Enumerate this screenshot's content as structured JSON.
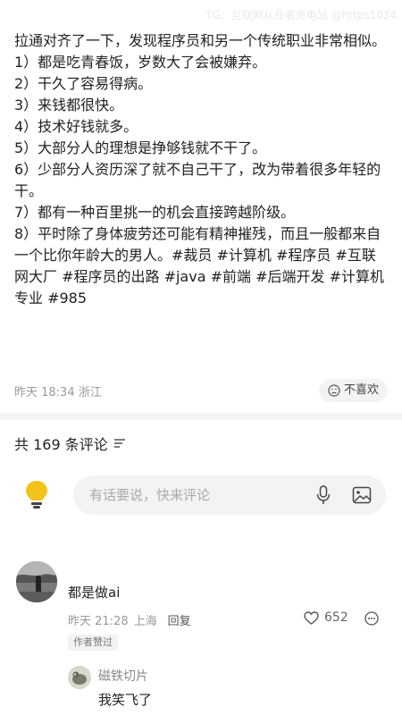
{
  "watermark": "TG：互联网从业者充电站 @https1024",
  "post": {
    "lines": [
      "拉通对齐了一下，发现程序员和另一个传统职业非常相似。",
      "1）都是吃青春饭，岁数大了会被嫌弃。",
      "2）干久了容易得病。",
      "3）来钱都很快。",
      "4）技术好钱就多。",
      "5）大部分人的理想是挣够钱就不干了。",
      "6）少部分人资历深了就不自己干了，改为带着很多年轻的干。",
      "7）都有一种百里挑一的机会直接跨越阶级。",
      "8）平时除了身体疲劳还可能有精神摧残，而且一般都来自一个比你年龄大的男人。#裁员 #计算机 #程序员 #互联网大厂 #程序员的出路 #java #前端 #后端开发 #计算机专业 #985"
    ],
    "time": "昨天 18:34 浙江",
    "dislike_label": "不喜欢"
  },
  "comments_header": "共 169 条评论",
  "comment_input": {
    "placeholder": "有话要说，快来评论"
  },
  "comment": {
    "text": "都是做ai",
    "time": "昨天 21:28",
    "location": "上海",
    "reply_label": "回复",
    "likes": "652",
    "badge": "作者赞过"
  },
  "sub_reply": {
    "name": "磁铁切片",
    "text": "我笑飞了"
  },
  "colors": {
    "text": "#222222",
    "meta": "#999999",
    "divider": "#f4f4f4",
    "bulb": "#f2c31b"
  }
}
